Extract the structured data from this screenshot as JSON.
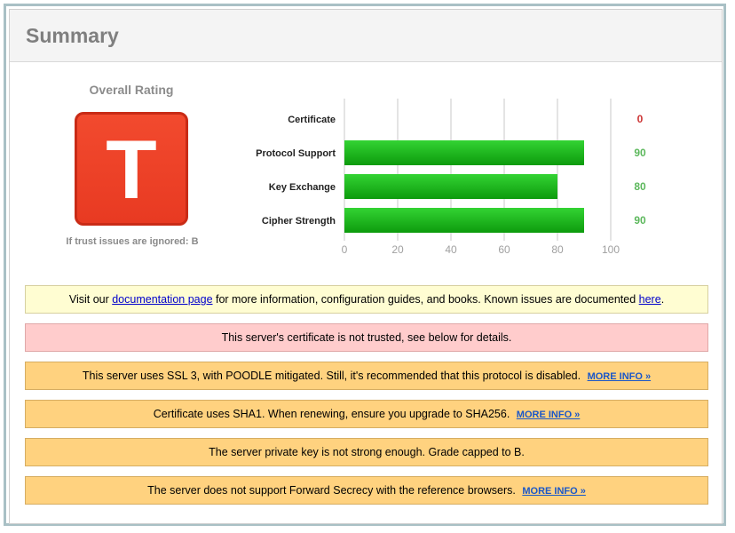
{
  "header": {
    "title": "Summary"
  },
  "rating": {
    "label": "Overall Rating",
    "grade": "T",
    "note": "If trust issues are ignored: B",
    "grade_color": "#e83a22"
  },
  "chart_data": {
    "type": "bar",
    "orientation": "horizontal",
    "categories": [
      "Certificate",
      "Protocol Support",
      "Key Exchange",
      "Cipher Strength"
    ],
    "values": [
      0,
      90,
      80,
      90
    ],
    "value_colors": [
      "#cc3333",
      "#5cb85c",
      "#5cb85c",
      "#5cb85c"
    ],
    "bar_color": "#19b319",
    "xlim": [
      0,
      100
    ],
    "ticks": [
      0,
      20,
      40,
      60,
      80,
      100
    ],
    "grid": true
  },
  "notices": [
    {
      "type": "info",
      "pre": "Visit our ",
      "link1": "documentation page",
      "mid": " for more information, configuration guides, and books. Known issues are documented ",
      "link2": "here",
      "post": "."
    },
    {
      "type": "error",
      "text": "This server's certificate is not trusted, see below for details."
    },
    {
      "type": "warn",
      "text": "This server uses SSL 3, with POODLE mitigated. Still, it's recommended that this protocol is disabled.",
      "more": "MORE INFO »"
    },
    {
      "type": "warn",
      "text": "Certificate uses SHA1. When renewing, ensure you upgrade to SHA256.",
      "more": "MORE INFO »"
    },
    {
      "type": "warn",
      "text": "The server private key is not strong enough. Grade capped to B."
    },
    {
      "type": "warn",
      "text": "The server does not support Forward Secrecy with the reference browsers.",
      "more": "MORE INFO »"
    }
  ]
}
